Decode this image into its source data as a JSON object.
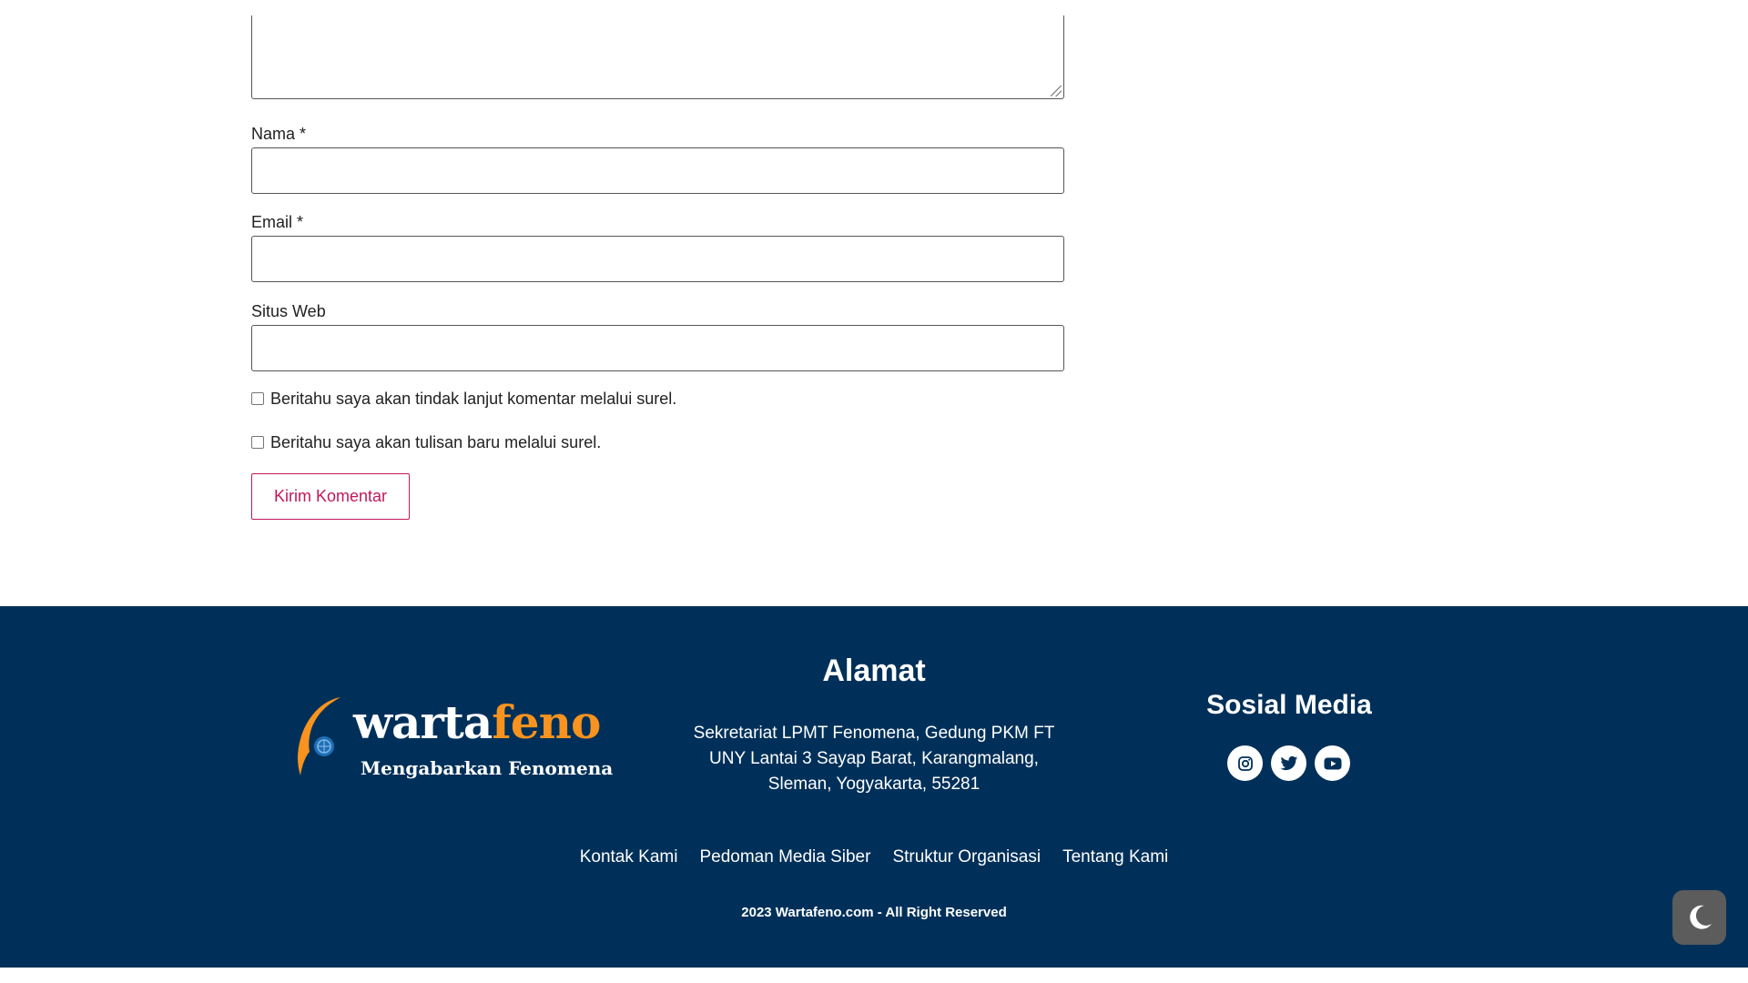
{
  "comment_form": {
    "name_label": "Nama *",
    "email_label": "Email *",
    "website_label": "Situs Web",
    "notify_comments_label": "Beritahu saya akan tindak lanjut komentar melalui surel.",
    "notify_posts_label": "Beritahu saya akan tulisan baru melalui surel.",
    "submit_label": "Kirim Komentar"
  },
  "footer": {
    "logo": {
      "word_part1": "warta",
      "word_part2": "feno",
      "tagline": "Mengabarkan Fenomena"
    },
    "address": {
      "title": "Alamat",
      "line1": "Sekretariat LPMT Fenomena, Gedung PKM FT",
      "line2": "UNY Lantai 3 Sayap Barat, Karangmalang,",
      "line3": "Sleman, Yogyakarta, 55281"
    },
    "social": {
      "title": "Sosial Media",
      "icons": [
        "instagram-icon",
        "twitter-icon",
        "youtube-icon"
      ]
    },
    "nav": [
      "Kontak Kami",
      "Pedoman Media Siber",
      "Struktur Organisasi",
      "Tentang Kami"
    ],
    "copyright": "2023 Wartafeno.com - All Right Reserved"
  },
  "dark_mode_toggle": {
    "icon": "moon-icon"
  },
  "colors": {
    "footer_bg": "#003059",
    "accent_pink": "#c2185b",
    "logo_orange": "#f7931e",
    "toggle_bg": "#5c5c5c"
  }
}
